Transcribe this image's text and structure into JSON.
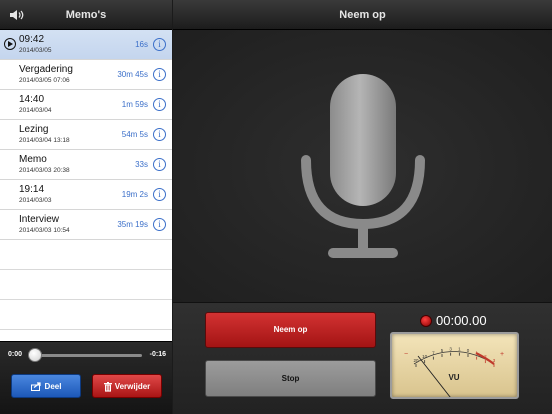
{
  "left_panel": {
    "title": "Memo's",
    "memos": [
      {
        "name": "09:42",
        "date": "2014/03/05",
        "duration": "16s",
        "selected": true
      },
      {
        "name": "Vergadering",
        "date": "2014/03/05 07:06",
        "duration": "30m 45s",
        "selected": false
      },
      {
        "name": "14:40",
        "date": "2014/03/04",
        "duration": "1m 59s",
        "selected": false
      },
      {
        "name": "Lezing",
        "date": "2014/03/04 13:18",
        "duration": "54m 5s",
        "selected": false
      },
      {
        "name": "Memo",
        "date": "2014/03/03 20:38",
        "duration": "33s",
        "selected": false
      },
      {
        "name": "19:14",
        "date": "2014/03/03",
        "duration": "19m 2s",
        "selected": false
      },
      {
        "name": "Interview",
        "date": "2014/03/03 10:54",
        "duration": "35m 19s",
        "selected": false
      }
    ],
    "player": {
      "elapsed": "0:00",
      "remaining": "-0:16",
      "progress": 0
    },
    "share_label": "Deel",
    "delete_label": "Verwijder"
  },
  "right_panel": {
    "title": "Neem op",
    "record_label": "Neem op",
    "stop_label": "Stop",
    "timer": "00:00.00",
    "vu": {
      "label": "VU",
      "scale": [
        "20",
        "10",
        "7",
        "5",
        "3",
        "1",
        "0",
        "1",
        "2",
        "3"
      ],
      "minus": "−",
      "plus": "+"
    }
  },
  "colors": {
    "selected_row": "#c9d9f0",
    "link_blue": "#3b6fc9",
    "share_blue": "#2a6fd0",
    "delete_red": "#c52020",
    "record_red": "#c02323",
    "stop_gray": "#8f8f8f",
    "vu_face": "#e8d6a4"
  },
  "icons": {
    "speaker": "speaker-icon",
    "play": "play-icon",
    "info": "info-icon",
    "share": "share-icon",
    "trash": "trash-icon",
    "microphone": "microphone-icon",
    "record_led": "record-led-icon"
  }
}
